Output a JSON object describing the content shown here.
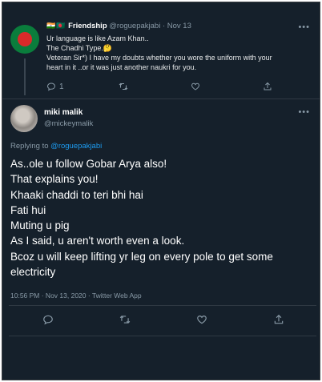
{
  "parent_tweet": {
    "flags": "🇮🇳🇧🇩",
    "display_name": "Friendship",
    "handle": "@roguepakjabi",
    "separator": "·",
    "date": "Nov 13",
    "more": "•••",
    "lines": [
      "Ur language is like Azam Khan..",
      "The Chadhi Type.🤔",
      "Veteran Sir*) I have my doubts whether you wore the uniform with your",
      "heart in it ..or it was just another naukri for you."
    ],
    "reply_count": "1"
  },
  "main_tweet": {
    "display_name": "miki malik",
    "handle": "@mickeymalik",
    "more": "•••",
    "replying_prefix": "Replying to ",
    "replying_handle": "@roguepakjabi",
    "lines": [
      "As..ole u follow Gobar Arya also!",
      "That explains you!",
      "Khaaki chaddi to teri bhi hai",
      "Fati hui",
      "Muting u pig",
      "As I said, u aren't worth even a look.",
      "Bcoz u will keep lifting yr leg on every pole to get some",
      "electricity"
    ],
    "timestamp": "10:56 PM · Nov 13, 2020 · Twitter Web App"
  },
  "colors": {
    "background": "#15202b",
    "muted": "#8899a6",
    "link": "#1d9bf0",
    "divider": "#2f3943"
  },
  "icons": [
    "reply-icon",
    "retweet-icon",
    "like-icon",
    "share-icon",
    "more-icon"
  ]
}
